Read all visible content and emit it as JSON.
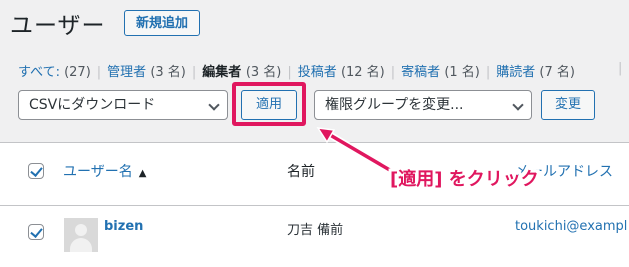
{
  "header": {
    "title": "ユーザー",
    "add_new_label": "新規追加"
  },
  "filters": [
    {
      "label": "すべて",
      "count": "(27)"
    },
    {
      "label": "管理者",
      "count": "(3 名)"
    },
    {
      "label": "編集者",
      "count": "(3 名)"
    },
    {
      "label": "投稿者",
      "count": "(12 名)"
    },
    {
      "label": "寄稿者",
      "count": "(1 名)"
    },
    {
      "label": "購読者",
      "count": "(7 名)"
    }
  ],
  "toolbar": {
    "bulk_action_value": "CSVにダウンロード",
    "apply_label": "適用",
    "role_change_value": "権限グループを変更...",
    "change_label": "変更"
  },
  "table": {
    "columns": {
      "username": "ユーザー名",
      "name": "名前",
      "email": "メールアドレス"
    },
    "rows": [
      {
        "username": "bizen",
        "name": "刀吉 備前",
        "email": "toukichi@exampl"
      }
    ]
  },
  "annotation": {
    "callout_text": "[適用] をクリック",
    "color": "#e0175f"
  }
}
